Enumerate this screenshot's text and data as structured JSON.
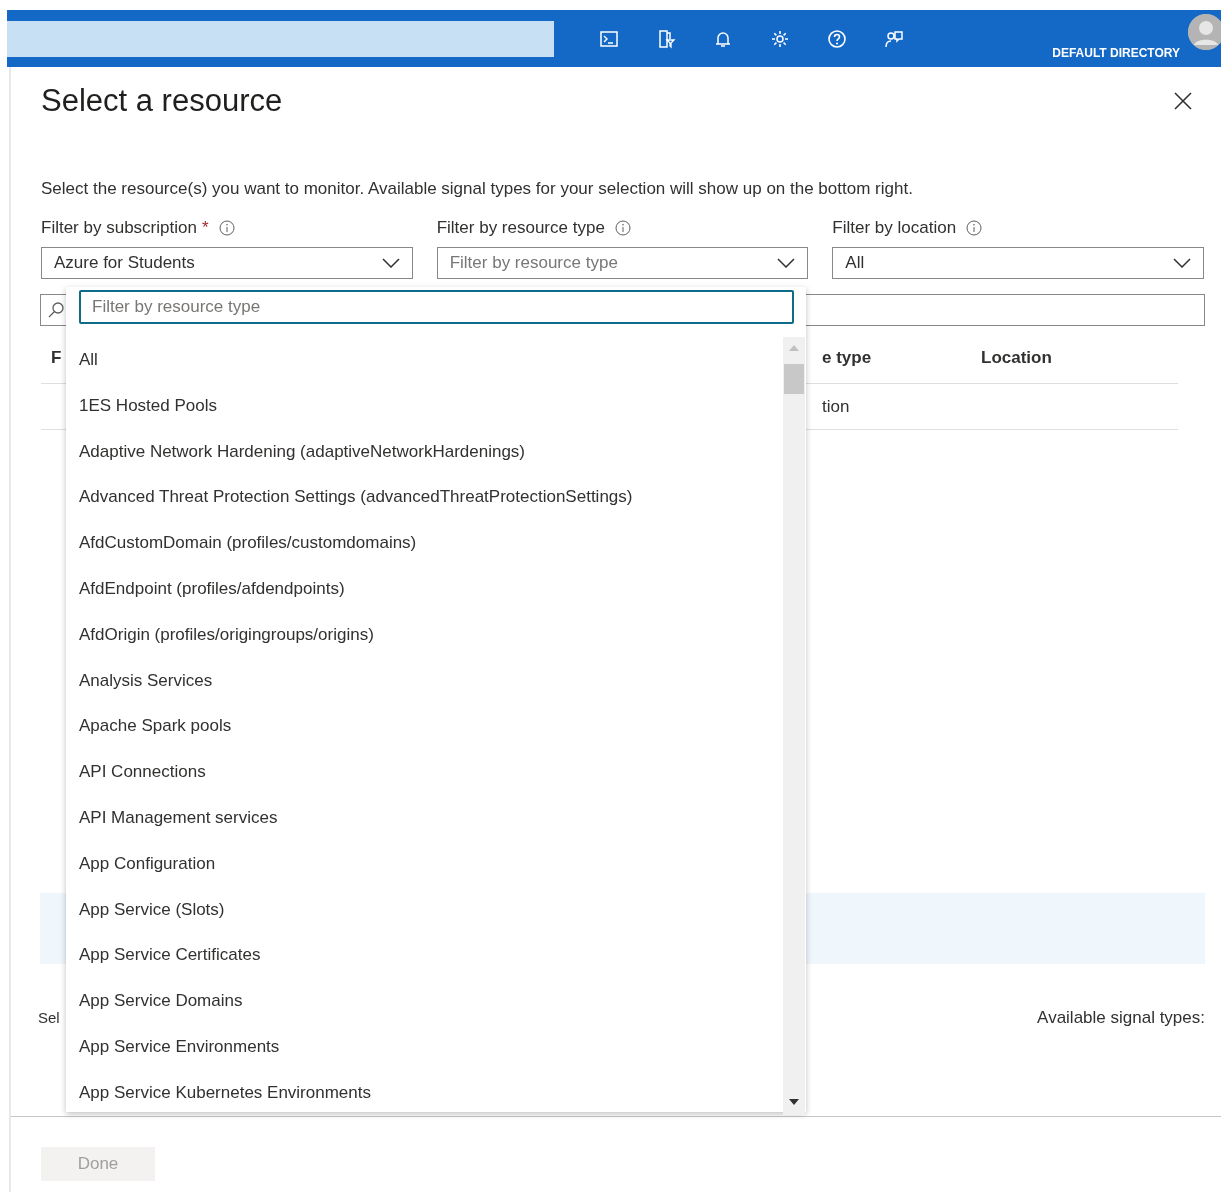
{
  "top_bar": {
    "directory": "DEFAULT DIRECTORY"
  },
  "blade": {
    "title": "Select a resource",
    "description": "Select the resource(s) you want to monitor. Available signal types for your selection will show up on the bottom right.",
    "filters": [
      {
        "label": "Filter by subscription",
        "required_mark": "*",
        "value": "Azure for Students"
      },
      {
        "label": "Filter by resource type",
        "placeholder": "Filter by resource type"
      },
      {
        "label": "Filter by location",
        "value": "All"
      }
    ],
    "table": {
      "columns": [
        "F",
        "e type",
        "Location"
      ],
      "rows": [
        {
          "column_2": "tion"
        }
      ]
    },
    "footer_left": "Sel",
    "signal_label": "Available signal types:",
    "done_button": {
      "label": "Done",
      "disabled": true
    }
  },
  "dropdown": {
    "placeholder": "Filter by resource type",
    "items": [
      "All",
      "1ES Hosted Pools",
      "Adaptive Network Hardening (adaptiveNetworkHardenings)",
      "Advanced Threat Protection Settings (advancedThreatProtectionSettings)",
      "AfdCustomDomain (profiles/customdomains)",
      "AfdEndpoint (profiles/afdendpoints)",
      "AfdOrigin (profiles/origingroups/origins)",
      "Analysis Services",
      "Apache Spark pools",
      "API Connections",
      "API Management services",
      "App Configuration",
      "App Service (Slots)",
      "App Service Certificates",
      "App Service Domains",
      "App Service Environments",
      "App Service Kubernetes Environments"
    ]
  }
}
